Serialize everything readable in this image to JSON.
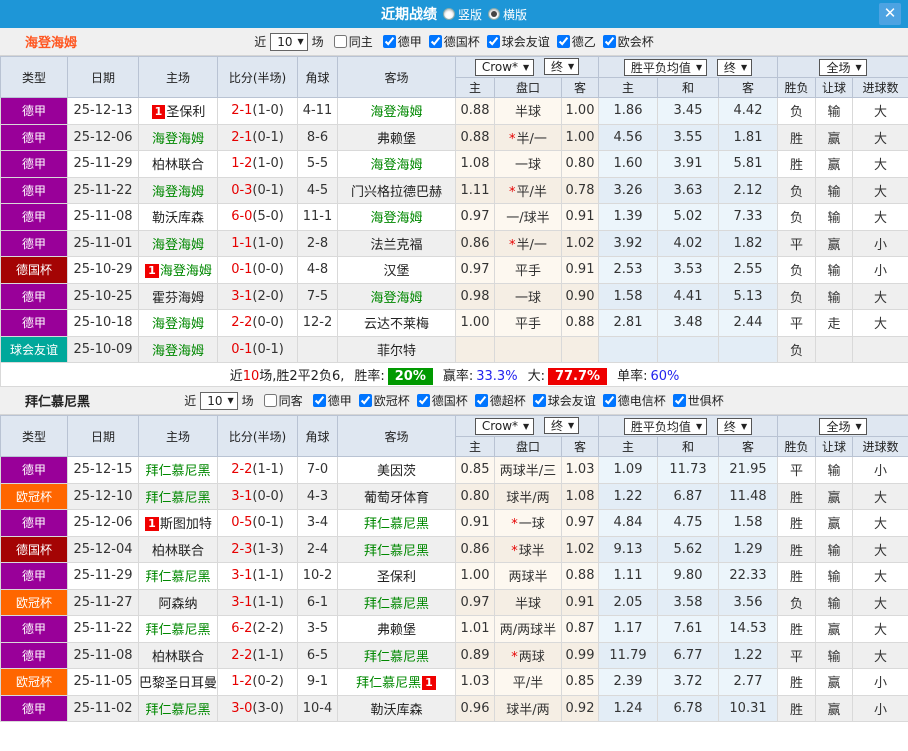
{
  "header": {
    "title": "近期战绩",
    "view_options": [
      {
        "label": "竖版",
        "selected": false
      },
      {
        "label": "横版",
        "selected": true
      }
    ],
    "close_glyph": "✕"
  },
  "columns": {
    "left": [
      "类型",
      "日期",
      "主场",
      "比分(半场)",
      "角球",
      "客场"
    ],
    "h_dd1": "Crow*",
    "h_dd2": "终",
    "h_cols": [
      "主",
      "盘口",
      "客"
    ],
    "m_dd1": "胜平负均值",
    "m_dd2": "终",
    "m_cols": [
      "主",
      "和",
      "客"
    ],
    "r_dd": "全场",
    "r_cols": [
      "胜负",
      "让球",
      "进球数"
    ]
  },
  "type_colors": {
    "德甲": "#990099",
    "德国杯": "#a40404",
    "球会友谊": "#00a89b",
    "欧冠杯": "#ff6600"
  },
  "outcome_colors": {
    "胜": "r",
    "平": "b",
    "负": "g",
    "赢": "r",
    "走": "b",
    "输": "g",
    "大": "r",
    "小": "g"
  },
  "sections": [
    {
      "team": "海登海姆",
      "title_color": "#ff5722",
      "filter": {
        "near_label": "近",
        "count": "10",
        "games_label": "场",
        "venue": {
          "label": "同主",
          "checked": false
        },
        "leagues": [
          {
            "label": "德甲",
            "checked": true
          },
          {
            "label": "德国杯",
            "checked": true
          },
          {
            "label": "球会友谊",
            "checked": true
          },
          {
            "label": "德乙",
            "checked": true
          },
          {
            "label": "欧会杯",
            "checked": true
          }
        ]
      },
      "rows": [
        {
          "type": "德甲",
          "date": "25-12-13",
          "home": {
            "name": "圣保利",
            "green": false,
            "badge": "1"
          },
          "score": "2-1",
          "half": "(1-0)",
          "corner": "4-11",
          "away": {
            "name": "海登海姆",
            "green": true
          },
          "o1": "0.88",
          "star": false,
          "hcap": "半球",
          "o2": "1.00",
          "m1": "1.86",
          "m2": "3.45",
          "m3": "4.42",
          "res": "负",
          "hres": "输",
          "goals": "大"
        },
        {
          "type": "德甲",
          "date": "25-12-06",
          "home": {
            "name": "海登海姆",
            "green": true
          },
          "score": "2-1",
          "half": "(0-1)",
          "corner": "8-6",
          "away": {
            "name": "弗赖堡",
            "green": false
          },
          "o1": "0.88",
          "star": true,
          "hcap": "半/一",
          "o2": "1.00",
          "m1": "4.56",
          "m2": "3.55",
          "m3": "1.81",
          "res": "胜",
          "hres": "赢",
          "goals": "大"
        },
        {
          "type": "德甲",
          "date": "25-11-29",
          "home": {
            "name": "柏林联合",
            "green": false
          },
          "score": "1-2",
          "half": "(1-0)",
          "corner": "5-5",
          "away": {
            "name": "海登海姆",
            "green": true
          },
          "o1": "1.08",
          "star": false,
          "hcap": "一球",
          "o2": "0.80",
          "m1": "1.60",
          "m2": "3.91",
          "m3": "5.81",
          "res": "胜",
          "hres": "赢",
          "goals": "大"
        },
        {
          "type": "德甲",
          "date": "25-11-22",
          "home": {
            "name": "海登海姆",
            "green": true
          },
          "score": "0-3",
          "half": "(0-1)",
          "corner": "4-5",
          "away": {
            "name": "门兴格拉德巴赫",
            "green": false
          },
          "o1": "1.11",
          "star": true,
          "hcap": "平/半",
          "o2": "0.78",
          "m1": "3.26",
          "m2": "3.63",
          "m3": "2.12",
          "res": "负",
          "hres": "输",
          "goals": "大"
        },
        {
          "type": "德甲",
          "date": "25-11-08",
          "home": {
            "name": "勒沃库森",
            "green": false
          },
          "score": "6-0",
          "half": "(5-0)",
          "corner": "11-1",
          "away": {
            "name": "海登海姆",
            "green": true
          },
          "o1": "0.97",
          "star": false,
          "hcap": "一/球半",
          "o2": "0.91",
          "m1": "1.39",
          "m2": "5.02",
          "m3": "7.33",
          "res": "负",
          "hres": "输",
          "goals": "大"
        },
        {
          "type": "德甲",
          "date": "25-11-01",
          "home": {
            "name": "海登海姆",
            "green": true
          },
          "score": "1-1",
          "half": "(1-0)",
          "corner": "2-8",
          "away": {
            "name": "法兰克福",
            "green": false
          },
          "o1": "0.86",
          "star": true,
          "hcap": "半/一",
          "o2": "1.02",
          "m1": "3.92",
          "m2": "4.02",
          "m3": "1.82",
          "res": "平",
          "hres": "赢",
          "goals": "小"
        },
        {
          "type": "德国杯",
          "date": "25-10-29",
          "home": {
            "name": "海登海姆",
            "green": true,
            "badge": "1"
          },
          "score": "0-1",
          "half": "(0-0)",
          "corner": "4-8",
          "away": {
            "name": "汉堡",
            "green": false
          },
          "o1": "0.97",
          "star": false,
          "hcap": "平手",
          "o2": "0.91",
          "m1": "2.53",
          "m2": "3.53",
          "m3": "2.55",
          "res": "负",
          "hres": "输",
          "goals": "小"
        },
        {
          "type": "德甲",
          "date": "25-10-25",
          "home": {
            "name": "霍芬海姆",
            "green": false
          },
          "score": "3-1",
          "half": "(2-0)",
          "corner": "7-5",
          "away": {
            "name": "海登海姆",
            "green": true
          },
          "o1": "0.98",
          "star": false,
          "hcap": "一球",
          "o2": "0.90",
          "m1": "1.58",
          "m2": "4.41",
          "m3": "5.13",
          "res": "负",
          "hres": "输",
          "goals": "大"
        },
        {
          "type": "德甲",
          "date": "25-10-18",
          "home": {
            "name": "海登海姆",
            "green": true
          },
          "score": "2-2",
          "half": "(0-0)",
          "corner": "12-2",
          "away": {
            "name": "云达不莱梅",
            "green": false
          },
          "o1": "1.00",
          "star": false,
          "hcap": "平手",
          "o2": "0.88",
          "m1": "2.81",
          "m2": "3.48",
          "m3": "2.44",
          "res": "平",
          "hres": "走",
          "goals": "大"
        },
        {
          "type": "球会友谊",
          "date": "25-10-09",
          "home": {
            "name": "海登海姆",
            "green": true
          },
          "score": "0-1",
          "half": "(0-1)",
          "corner": "",
          "away": {
            "name": "菲尔特",
            "green": false
          },
          "o1": "",
          "star": false,
          "hcap": "",
          "o2": "",
          "m1": "",
          "m2": "",
          "m3": "",
          "res": "负",
          "hres": "",
          "goals": ""
        }
      ],
      "summary": {
        "near": "近",
        "count": "10",
        "rest": "场,胜2平2负6,",
        "win_label": "胜率:",
        "win": "20%",
        "profit_label": "赢率:",
        "profit": "33.3%",
        "big_label": "大:",
        "big": "77.7%",
        "single_label": "单率:",
        "single": "60%"
      }
    },
    {
      "team": "拜仁慕尼黑",
      "title_color": "#222222",
      "filter": {
        "near_label": "近",
        "count": "10",
        "games_label": "场",
        "venue": {
          "label": "同客",
          "checked": false
        },
        "leagues": [
          {
            "label": "德甲",
            "checked": true
          },
          {
            "label": "欧冠杯",
            "checked": true
          },
          {
            "label": "德国杯",
            "checked": true
          },
          {
            "label": "德超杯",
            "checked": true
          },
          {
            "label": "球会友谊",
            "checked": true
          },
          {
            "label": "德电信杯",
            "checked": true
          },
          {
            "label": "世俱杯",
            "checked": true
          }
        ]
      },
      "rows": [
        {
          "type": "德甲",
          "date": "25-12-15",
          "home": {
            "name": "拜仁慕尼黑",
            "green": true
          },
          "score": "2-2",
          "half": "(1-1)",
          "corner": "7-0",
          "away": {
            "name": "美因茨",
            "green": false
          },
          "o1": "0.85",
          "star": false,
          "hcap": "两球半/三",
          "o2": "1.03",
          "m1": "1.09",
          "m2": "11.73",
          "m3": "21.95",
          "res": "平",
          "hres": "输",
          "goals": "小"
        },
        {
          "type": "欧冠杯",
          "date": "25-12-10",
          "home": {
            "name": "拜仁慕尼黑",
            "green": true
          },
          "score": "3-1",
          "half": "(0-0)",
          "corner": "4-3",
          "away": {
            "name": "葡萄牙体育",
            "green": false
          },
          "o1": "0.80",
          "star": false,
          "hcap": "球半/两",
          "o2": "1.08",
          "m1": "1.22",
          "m2": "6.87",
          "m3": "11.48",
          "res": "胜",
          "hres": "赢",
          "goals": "大"
        },
        {
          "type": "德甲",
          "date": "25-12-06",
          "home": {
            "name": "斯图加特",
            "green": false,
            "badge": "1"
          },
          "score": "0-5",
          "half": "(0-1)",
          "corner": "3-4",
          "away": {
            "name": "拜仁慕尼黑",
            "green": true
          },
          "o1": "0.91",
          "star": true,
          "hcap": "一球",
          "o2": "0.97",
          "m1": "4.84",
          "m2": "4.75",
          "m3": "1.58",
          "res": "胜",
          "hres": "赢",
          "goals": "大"
        },
        {
          "type": "德国杯",
          "date": "25-12-04",
          "home": {
            "name": "柏林联合",
            "green": false
          },
          "score": "2-3",
          "half": "(1-3)",
          "corner": "2-4",
          "away": {
            "name": "拜仁慕尼黑",
            "green": true
          },
          "o1": "0.86",
          "star": true,
          "hcap": "球半",
          "o2": "1.02",
          "m1": "9.13",
          "m2": "5.62",
          "m3": "1.29",
          "res": "胜",
          "hres": "输",
          "goals": "大"
        },
        {
          "type": "德甲",
          "date": "25-11-29",
          "home": {
            "name": "拜仁慕尼黑",
            "green": true
          },
          "score": "3-1",
          "half": "(1-1)",
          "corner": "10-2",
          "away": {
            "name": "圣保利",
            "green": false
          },
          "o1": "1.00",
          "star": false,
          "hcap": "两球半",
          "o2": "0.88",
          "m1": "1.11",
          "m2": "9.80",
          "m3": "22.33",
          "res": "胜",
          "hres": "输",
          "goals": "大"
        },
        {
          "type": "欧冠杯",
          "date": "25-11-27",
          "home": {
            "name": "阿森纳",
            "green": false
          },
          "score": "3-1",
          "half": "(1-1)",
          "corner": "6-1",
          "away": {
            "name": "拜仁慕尼黑",
            "green": true
          },
          "o1": "0.97",
          "star": false,
          "hcap": "半球",
          "o2": "0.91",
          "m1": "2.05",
          "m2": "3.58",
          "m3": "3.56",
          "res": "负",
          "hres": "输",
          "goals": "大"
        },
        {
          "type": "德甲",
          "date": "25-11-22",
          "home": {
            "name": "拜仁慕尼黑",
            "green": true
          },
          "score": "6-2",
          "half": "(2-2)",
          "corner": "3-5",
          "away": {
            "name": "弗赖堡",
            "green": false
          },
          "o1": "1.01",
          "star": false,
          "hcap": "两/两球半",
          "o2": "0.87",
          "m1": "1.17",
          "m2": "7.61",
          "m3": "14.53",
          "res": "胜",
          "hres": "赢",
          "goals": "大"
        },
        {
          "type": "德甲",
          "date": "25-11-08",
          "home": {
            "name": "柏林联合",
            "green": false
          },
          "score": "2-2",
          "half": "(1-1)",
          "corner": "6-5",
          "away": {
            "name": "拜仁慕尼黑",
            "green": true
          },
          "o1": "0.89",
          "star": true,
          "hcap": "两球",
          "o2": "0.99",
          "m1": "11.79",
          "m2": "6.77",
          "m3": "1.22",
          "res": "平",
          "hres": "输",
          "goals": "大"
        },
        {
          "type": "欧冠杯",
          "date": "25-11-05",
          "home": {
            "name": "巴黎圣日耳曼",
            "green": false
          },
          "score": "1-2",
          "half": "(0-2)",
          "corner": "9-1",
          "away": {
            "name": "拜仁慕尼黑",
            "green": true,
            "badge": "1",
            "badge_after": true
          },
          "o1": "1.03",
          "star": false,
          "hcap": "平/半",
          "o2": "0.85",
          "m1": "2.39",
          "m2": "3.72",
          "m3": "2.77",
          "res": "胜",
          "hres": "赢",
          "goals": "小"
        },
        {
          "type": "德甲",
          "date": "25-11-02",
          "home": {
            "name": "拜仁慕尼黑",
            "green": true
          },
          "score": "3-0",
          "half": "(3-0)",
          "corner": "10-4",
          "away": {
            "name": "勒沃库森",
            "green": false
          },
          "o1": "0.96",
          "star": false,
          "hcap": "球半/两",
          "o2": "0.92",
          "m1": "1.24",
          "m2": "6.78",
          "m3": "10.31",
          "res": "胜",
          "hres": "赢",
          "goals": "小"
        }
      ]
    }
  ]
}
